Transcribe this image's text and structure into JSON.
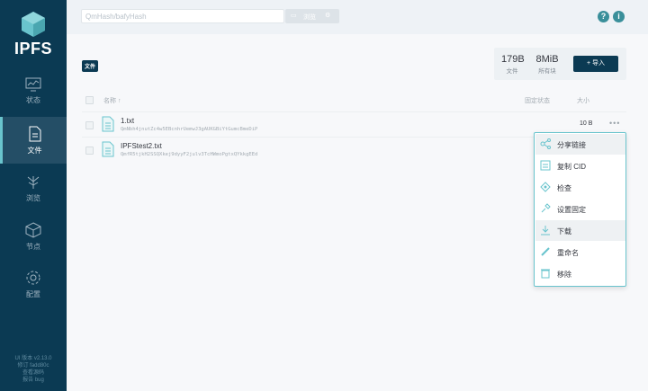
{
  "app": {
    "logo_text": "IPFS"
  },
  "sidebar": {
    "items": [
      {
        "label": "状态",
        "icon": "monitor-icon"
      },
      {
        "label": "文件",
        "icon": "document-icon"
      },
      {
        "label": "浏览",
        "icon": "tree-icon"
      },
      {
        "label": "节点",
        "icon": "cube-icon"
      },
      {
        "label": "配置",
        "icon": "gear-icon"
      }
    ],
    "footer": [
      "UI 版本 v2.13.0",
      "修订 fadd80c",
      "查看源码",
      "报告 bug"
    ]
  },
  "topbar": {
    "search_placeholder": "QmHash/bafyHash",
    "browse_label": "浏览"
  },
  "main": {
    "page_label": "文件",
    "stats": [
      {
        "value": "179B",
        "caption": "文件"
      },
      {
        "value": "8MiB",
        "caption": "所有块"
      }
    ],
    "import_label": "+ 导入"
  },
  "table": {
    "headers": {
      "name": "名称 ↑",
      "pin": "固定状态",
      "size": "大小"
    },
    "rows": [
      {
        "name": "1.txt",
        "hash": "QmNbh4jnutZc4w5EBcnhrUemwJ3gAUKGBiYtGumcBmeDiP",
        "size": "10 B"
      },
      {
        "name": "IPFStest2.txt",
        "hash": "QmfR5tjkH2SSQXkej9dyyF2julv3TcHWmoPgtxQYkkgEEd",
        "size": ""
      }
    ]
  },
  "context_menu": {
    "items": [
      {
        "label": "分享链接",
        "icon": "share-icon"
      },
      {
        "label": "复制 CID",
        "icon": "copy-icon"
      },
      {
        "label": "检查",
        "icon": "inspect-icon"
      },
      {
        "label": "设置固定",
        "icon": "pin-icon"
      },
      {
        "label": "下载",
        "icon": "download-icon"
      },
      {
        "label": "重命名",
        "icon": "pencil-icon"
      },
      {
        "label": "移除",
        "icon": "trash-icon"
      }
    ]
  },
  "colors": {
    "navy": "#0b3a53",
    "teal": "#69c4cd",
    "accent": "#3a8f9a"
  }
}
